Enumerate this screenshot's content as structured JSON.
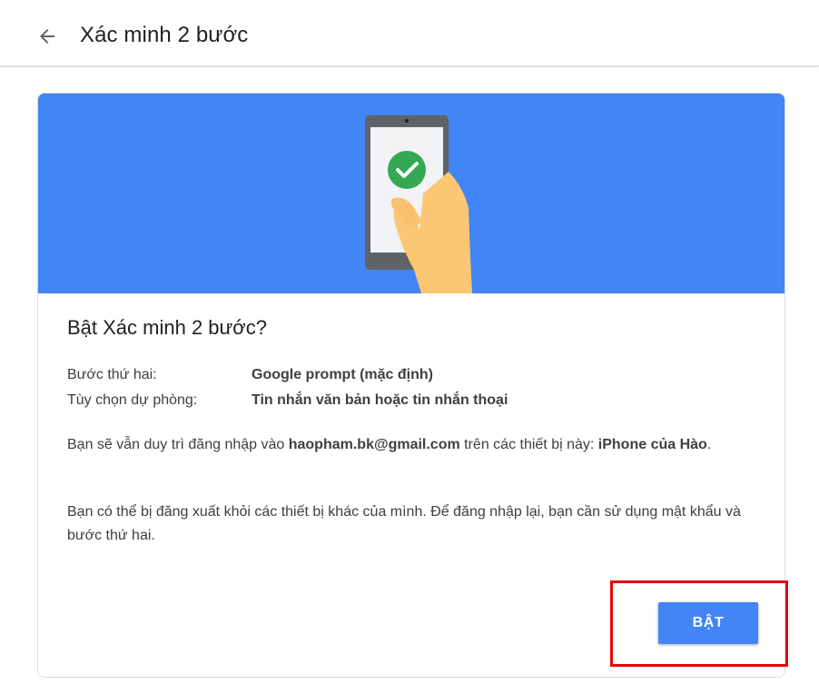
{
  "header": {
    "back_icon": "arrow-left-icon",
    "title": "Xác minh 2 bước"
  },
  "hero": {
    "illustration": "phone-with-checkmark-illustration",
    "colors": {
      "background": "#4285f4",
      "check": "#34a853",
      "hand": "#fbc774"
    }
  },
  "card": {
    "title": "Bật Xác minh 2 bước?",
    "rows": [
      {
        "label": "Bước thứ hai:",
        "value": "Google prompt (mặc định)"
      },
      {
        "label": "Tùy chọn dự phòng:",
        "value": "Tin nhắn văn bản hoặc tin nhắn thoại"
      }
    ],
    "para1": {
      "prefix": "Bạn sẽ vẫn duy trì đăng nhập vào ",
      "email": "haopham.bk@gmail.com",
      "middle": " trên các thiết bị này: ",
      "device": "iPhone của Hào",
      "suffix": "."
    },
    "para2": "Bạn có thể bị đăng xuất khỏi các thiết bị khác của mình. Để đăng nhập lại, bạn cần sử dụng mật khẩu và bước thứ hai.",
    "button_label": "BẬT",
    "accent_color": "#4285f4",
    "highlight_color": "#e8080c"
  }
}
